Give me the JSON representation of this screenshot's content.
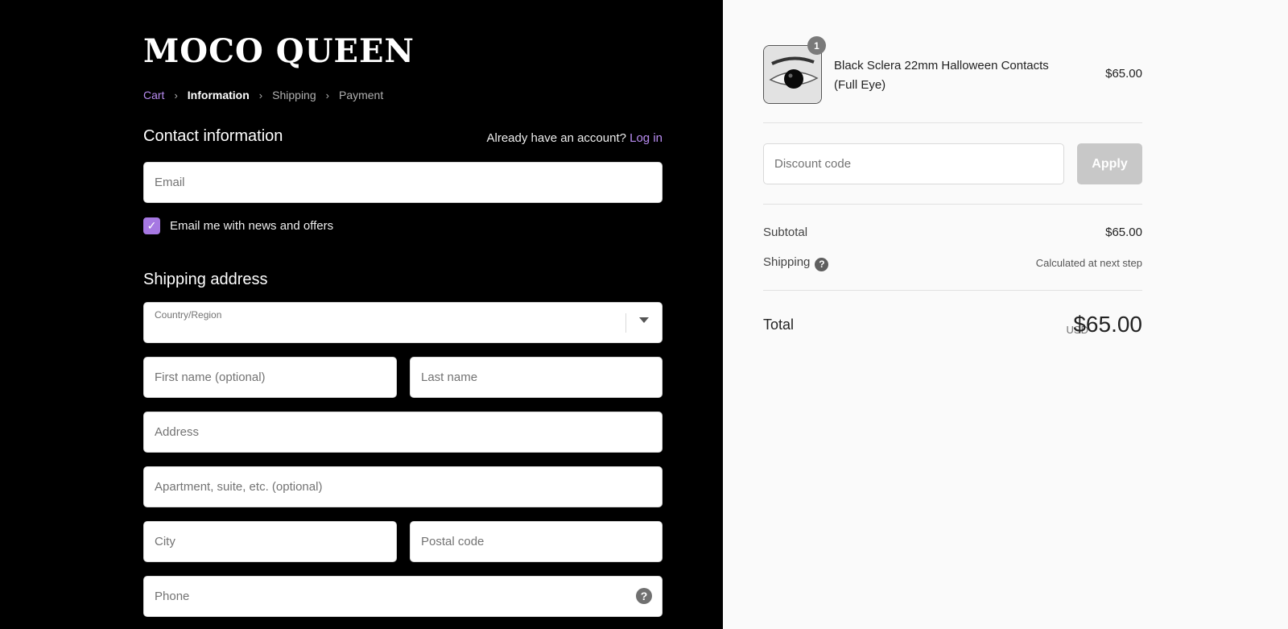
{
  "brand": {
    "logo_text": "MOCO QUEEN"
  },
  "breadcrumb": {
    "items": [
      "Cart",
      "Information",
      "Shipping",
      "Payment"
    ],
    "separator": "›"
  },
  "contact": {
    "title": "Contact information",
    "account_prompt": "Already have an account?",
    "login_label": "Log in",
    "email_placeholder": "Email",
    "newsletter_label": "Email me with news and offers",
    "newsletter_checked": true
  },
  "shipping": {
    "title": "Shipping address",
    "country_label": "Country/Region",
    "first_name_placeholder": "First name (optional)",
    "last_name_placeholder": "Last name",
    "address_placeholder": "Address",
    "apartment_placeholder": "Apartment, suite, etc. (optional)",
    "city_placeholder": "City",
    "postal_placeholder": "Postal code",
    "phone_placeholder": "Phone"
  },
  "order": {
    "product": {
      "name": "Black Sclera 22mm Halloween Contacts (Full Eye)",
      "price": "$65.00",
      "quantity": "1"
    },
    "discount_placeholder": "Discount code",
    "apply_label": "Apply",
    "subtotal_label": "Subtotal",
    "subtotal_value": "$65.00",
    "shipping_label": "Shipping",
    "shipping_value": "Calculated at next step",
    "total_label": "Total",
    "currency": "USD",
    "total_value": "$65.00"
  },
  "icons": {
    "check": "checkmark-icon",
    "caret": "caret-down-icon",
    "help": "question-circle-icon"
  },
  "colors": {
    "accent": "#a678e2",
    "link": "#b98cf2",
    "left_bg": "#000000",
    "right_bg": "#fafafa",
    "apply_button": "#c8c8c8"
  }
}
